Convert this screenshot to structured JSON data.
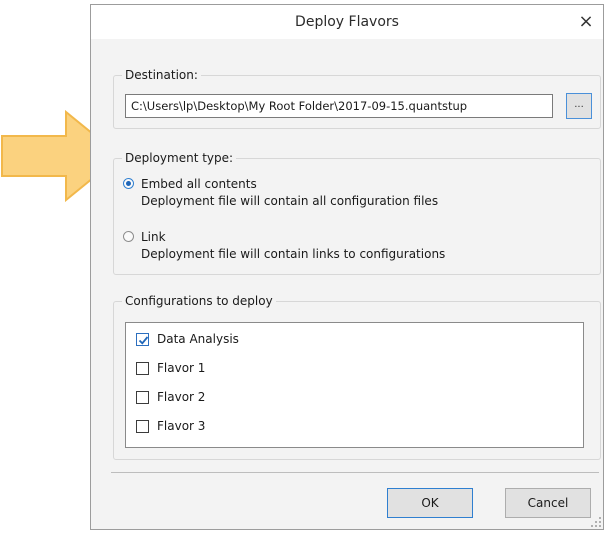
{
  "dialog": {
    "title": "Deploy Flavors",
    "close_glyph": "×"
  },
  "destination": {
    "legend": "Destination:",
    "path": "C:\\Users\\lp\\Desktop\\My Root Folder\\2017-09-15.quantstup",
    "browse_label": "..."
  },
  "deployment": {
    "legend": "Deployment type:",
    "options": [
      {
        "label": "Embed all contents",
        "description": "Deployment file will contain all configuration files",
        "selected": true
      },
      {
        "label": "Link",
        "description": "Deployment file will contain links to configurations",
        "selected": false
      }
    ]
  },
  "configurations": {
    "legend": "Configurations to deploy",
    "items": [
      {
        "label": "Data Analysis",
        "checked": true
      },
      {
        "label": "Flavor 1",
        "checked": false
      },
      {
        "label": "Flavor 2",
        "checked": false
      },
      {
        "label": "Flavor 3",
        "checked": false
      }
    ]
  },
  "buttons": {
    "ok": "OK",
    "cancel": "Cancel"
  },
  "icons": {
    "pointer_arrow": "arrow-right-icon",
    "close": "close-icon",
    "check": "checkmark-icon",
    "grip": "resize-grip-icon"
  },
  "colors": {
    "arrow_fill": "#fbd27f",
    "arrow_stroke": "#f2b84b",
    "accent": "#2f7fd0",
    "dialog_bg": "#f3f3f3"
  }
}
